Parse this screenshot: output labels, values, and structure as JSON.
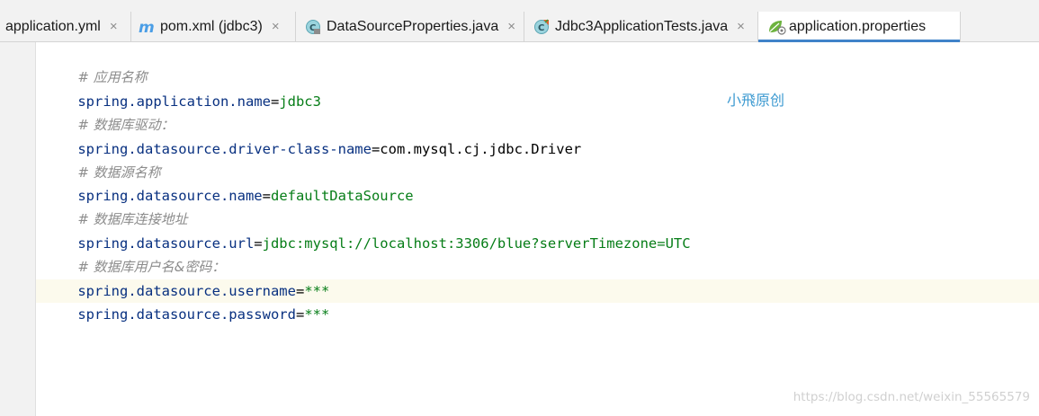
{
  "tabs": [
    {
      "label": "application.yml",
      "icon": "yaml-file-icon",
      "closable": true,
      "active": false
    },
    {
      "label": "pom.xml (jdbc3)",
      "icon": "maven-m-icon",
      "closable": true,
      "active": false
    },
    {
      "label": "DataSourceProperties.java",
      "icon": "java-class-icon",
      "closable": true,
      "active": false
    },
    {
      "label": "Jdbc3ApplicationTests.java",
      "icon": "java-test-class-icon",
      "closable": true,
      "active": false
    },
    {
      "label": "application.properties",
      "icon": "spring-properties-icon",
      "closable": false,
      "active": true
    }
  ],
  "close_glyph": "×",
  "colors": {
    "tab_active_underline": "#4083c9",
    "comment": "#8c8c8c",
    "property_key": "#083080",
    "property_value": "#067d17",
    "current_line": "#fcfaed",
    "watermark": "#3d9ad1"
  },
  "editor": {
    "lines": [
      {
        "type": "comment",
        "text": "# 应用名称"
      },
      {
        "type": "property",
        "key": "spring.application.name",
        "value": "jdbc3"
      },
      {
        "type": "comment",
        "text": "# 数据库驱动："
      },
      {
        "type": "property",
        "key": "spring.datasource.driver-class-name",
        "value": "com.mysql.cj.jdbc.Driver"
      },
      {
        "type": "comment",
        "text": "# 数据源名称"
      },
      {
        "type": "property",
        "key": "spring.datasource.name",
        "value": "defaultDataSource"
      },
      {
        "type": "comment",
        "text": "# 数据库连接地址"
      },
      {
        "type": "property",
        "key": "spring.datasource.url",
        "value": "jdbc:mysql://localhost:3306/blue?serverTimezone=UTC"
      },
      {
        "type": "comment",
        "text": "# 数据库用户名&密码："
      },
      {
        "type": "property",
        "key": "spring.datasource.username",
        "value": "***"
      },
      {
        "type": "property",
        "key": "spring.datasource.password",
        "value": "***"
      }
    ]
  },
  "watermark_text": "小飛原创",
  "footer_watermark": "https://blog.csdn.net/weixin_55565579"
}
